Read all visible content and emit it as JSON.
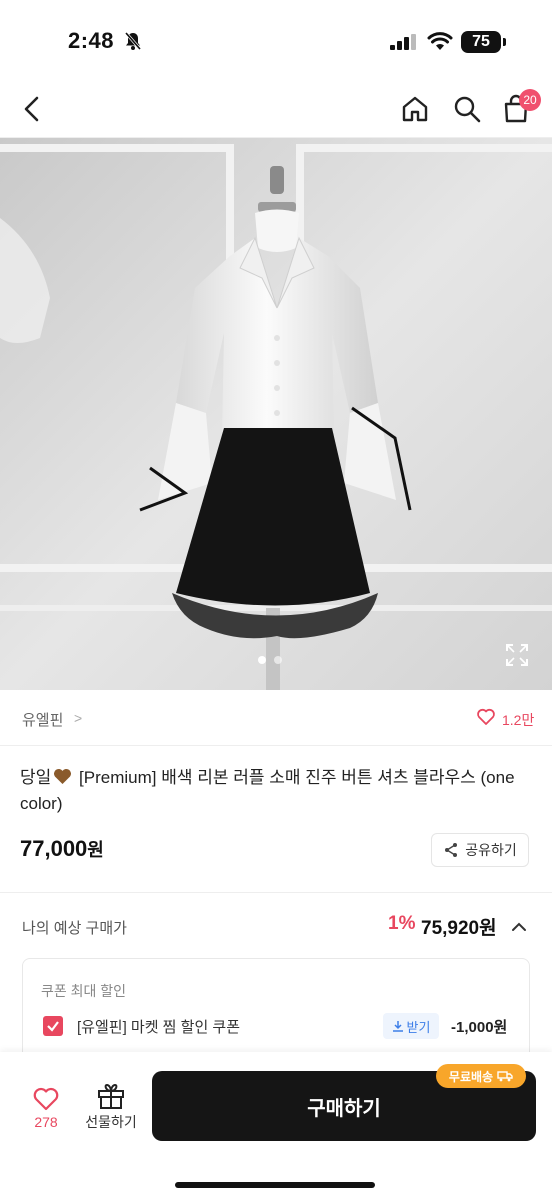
{
  "status_bar": {
    "time": "2:48",
    "battery": "75"
  },
  "nav": {
    "cart_count": "20"
  },
  "hero": {
    "dots_total": 2,
    "dot_active": 1
  },
  "shop": {
    "name": "유엘핀",
    "chevron": ">",
    "likes": "1.2만"
  },
  "product": {
    "title_prefix": "당일",
    "title_main": "[Premium] 배색 리본 러플 소매 진주 버튼 셔츠 블라우스 (one color)",
    "price": "77,000",
    "price_unit": "원",
    "share_label": "공유하기"
  },
  "estimate": {
    "label": "나의 예상 구매가",
    "discount_pct": "1%",
    "price": "75,920원"
  },
  "coupon": {
    "heading": "쿠폰 최대 할인",
    "name": "[유엘핀] 마켓 찜 할인 쿠폰",
    "get_label": "받기",
    "amount": "-1,000원"
  },
  "bottom_bar": {
    "wish_count": "278",
    "gift_label": "선물하기",
    "buy_label": "구매하기",
    "free_shipping_label": "무료배송"
  },
  "colors": {
    "accent_red": "#e8475f",
    "badge_orange": "#f8a62a",
    "buy_button": "#151515",
    "link_blue": "#3d7ee8"
  }
}
